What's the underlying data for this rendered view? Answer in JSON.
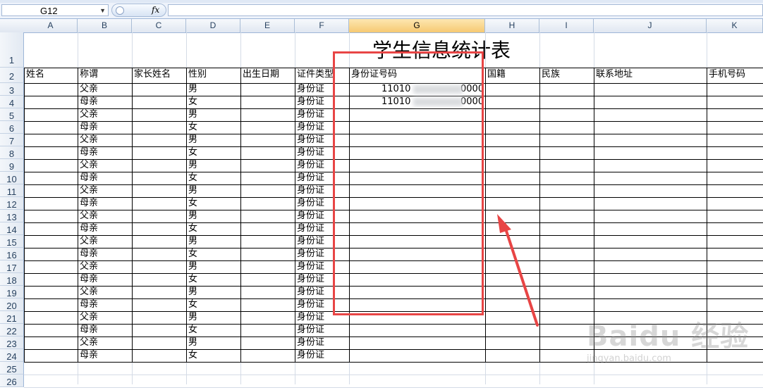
{
  "formula_bar": {
    "cell_ref": "G12",
    "fx_label": "fx",
    "formula": ""
  },
  "columns": [
    "A",
    "B",
    "C",
    "D",
    "E",
    "F",
    "G",
    "H",
    "I",
    "J",
    "K"
  ],
  "selected_column": "G",
  "rows": [
    "1",
    "2",
    "3",
    "4",
    "5",
    "6",
    "7",
    "8",
    "9",
    "10",
    "11",
    "12",
    "13",
    "14",
    "15",
    "16",
    "17",
    "18",
    "19",
    "20",
    "21",
    "22",
    "23",
    "24",
    "25",
    "26"
  ],
  "sheet": {
    "title": "学生信息统计表",
    "headers": {
      "A": "姓名",
      "B": "称谓",
      "C": "家长姓名",
      "D": "性别",
      "E": "出生日期",
      "F": "证件类型",
      "G": "身份证号码",
      "H": "国籍",
      "I": "民族",
      "J": "联系地址",
      "K": "手机号码"
    },
    "data_rows": [
      {
        "b": "父亲",
        "d": "男",
        "f": "身份证",
        "g_start": "11010",
        "g_end": "0000"
      },
      {
        "b": "母亲",
        "d": "女",
        "f": "身份证",
        "g_start": "11010",
        "g_end": "0000"
      },
      {
        "b": "父亲",
        "d": "男",
        "f": "身份证"
      },
      {
        "b": "母亲",
        "d": "女",
        "f": "身份证"
      },
      {
        "b": "父亲",
        "d": "男",
        "f": "身份证"
      },
      {
        "b": "母亲",
        "d": "女",
        "f": "身份证"
      },
      {
        "b": "父亲",
        "d": "男",
        "f": "身份证"
      },
      {
        "b": "母亲",
        "d": "女",
        "f": "身份证"
      },
      {
        "b": "父亲",
        "d": "男",
        "f": "身份证"
      },
      {
        "b": "母亲",
        "d": "女",
        "f": "身份证"
      },
      {
        "b": "父亲",
        "d": "男",
        "f": "身份证"
      },
      {
        "b": "母亲",
        "d": "女",
        "f": "身份证"
      },
      {
        "b": "父亲",
        "d": "男",
        "f": "身份证"
      },
      {
        "b": "母亲",
        "d": "女",
        "f": "身份证"
      },
      {
        "b": "父亲",
        "d": "男",
        "f": "身份证"
      },
      {
        "b": "母亲",
        "d": "女",
        "f": "身份证"
      },
      {
        "b": "父亲",
        "d": "男",
        "f": "身份证"
      },
      {
        "b": "母亲",
        "d": "女",
        "f": "身份证"
      },
      {
        "b": "父亲",
        "d": "男",
        "f": "身份证"
      },
      {
        "b": "母亲",
        "d": "女",
        "f": "身份证"
      },
      {
        "b": "父亲",
        "d": "男",
        "f": "身份证"
      },
      {
        "b": "母亲",
        "d": "女",
        "f": "身份证"
      }
    ]
  },
  "annotation": {
    "color": "#e84545"
  },
  "watermark": {
    "main": "Baidu 经验",
    "url": "jingyan.baidu.com"
  }
}
